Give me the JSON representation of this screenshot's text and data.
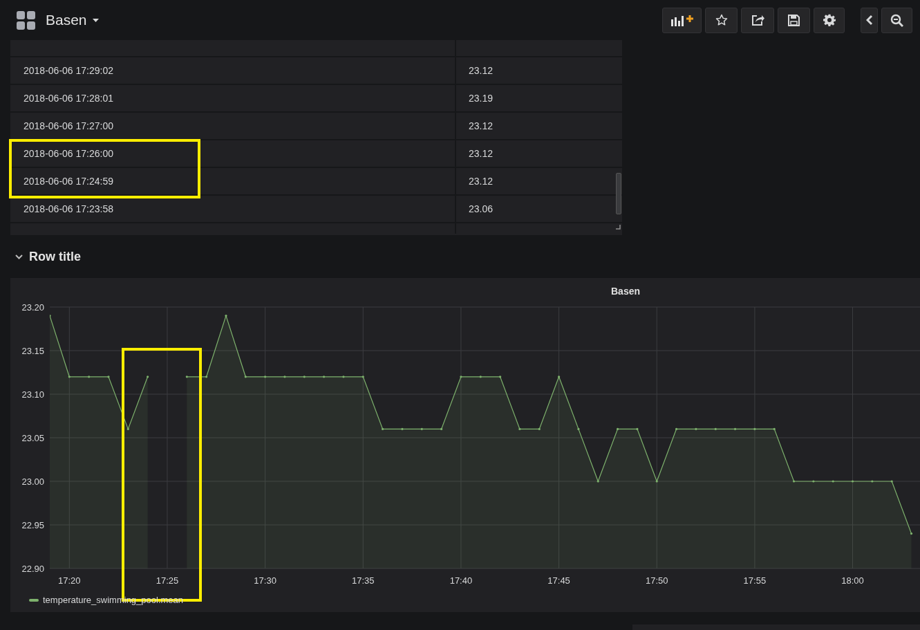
{
  "navbar": {
    "title": "Basen",
    "buttons": [
      {
        "kind": "add-panel"
      },
      {
        "kind": "star"
      },
      {
        "kind": "share"
      },
      {
        "kind": "save"
      },
      {
        "kind": "settings"
      },
      {
        "kind": "back"
      },
      {
        "kind": "zoom-out"
      }
    ]
  },
  "table": {
    "rows": [
      {
        "time": "2018-06-06 17:29:02",
        "value": "23.12",
        "highlighted": false
      },
      {
        "time": "2018-06-06 17:28:01",
        "value": "23.19",
        "highlighted": false
      },
      {
        "time": "2018-06-06 17:27:00",
        "value": "23.12",
        "highlighted": false
      },
      {
        "time": "2018-06-06 17:26:00",
        "value": "23.12",
        "highlighted": true
      },
      {
        "time": "2018-06-06 17:24:59",
        "value": "23.12",
        "highlighted": true
      },
      {
        "time": "2018-06-06 17:23:58",
        "value": "23.06",
        "highlighted": false
      }
    ]
  },
  "row_title": {
    "title": "Row title",
    "expanded": true
  },
  "graph": {
    "title": "Basen",
    "chart_data": {
      "type": "area",
      "grid": true,
      "categories": [
        null,
        "17:20",
        null,
        null,
        null,
        null,
        "17:25",
        null,
        null,
        null,
        null,
        "17:30",
        null,
        null,
        null,
        null,
        "17:35",
        null,
        null,
        null,
        null,
        "17:40",
        null,
        null,
        null,
        null,
        "17:45",
        null,
        null,
        null,
        null,
        "17:50",
        null,
        null,
        null,
        null,
        "17:55",
        null,
        null,
        null,
        null,
        "18:00",
        null,
        null,
        null
      ],
      "series": [
        {
          "name": "temperature_swimming_pool.mean",
          "color": "#7eb26d",
          "values": [
            23.19,
            23.12,
            23.12,
            23.12,
            23.06,
            23.12,
            null,
            23.12,
            23.12,
            23.19,
            23.12,
            23.12,
            23.12,
            23.12,
            23.12,
            23.12,
            23.12,
            23.06,
            23.06,
            23.06,
            23.06,
            23.12,
            23.12,
            23.12,
            23.06,
            23.06,
            23.12,
            23.06,
            23.0,
            23.06,
            23.06,
            23.0,
            23.06,
            23.06,
            23.06,
            23.06,
            23.06,
            23.06,
            23.0,
            23.0,
            23.0,
            23.0,
            23.0,
            23.0,
            22.94
          ]
        }
      ],
      "ylim": [
        22.9,
        23.2
      ],
      "yticks": [
        {
          "value": 22.9,
          "label": "22.90"
        },
        {
          "value": 22.95,
          "label": "22.95"
        },
        {
          "value": 23.0,
          "label": "23.00"
        },
        {
          "value": 23.05,
          "label": "23.05"
        },
        {
          "value": 23.1,
          "label": "23.10"
        },
        {
          "value": 23.15,
          "label": "23.15"
        },
        {
          "value": 23.2,
          "label": "23.20"
        }
      ]
    }
  }
}
